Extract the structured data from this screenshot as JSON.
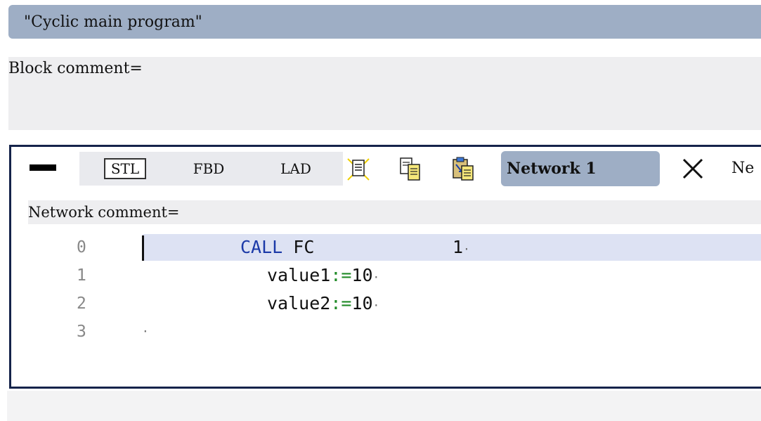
{
  "block": {
    "title": "\"Cyclic main program\"",
    "comment_label": "Block comment="
  },
  "network": {
    "tabs": [
      {
        "label": "STL",
        "selected": true
      },
      {
        "label": "FBD",
        "selected": false
      },
      {
        "label": "LAD",
        "selected": false
      }
    ],
    "toolbar_icons": [
      "new-page-icon",
      "copy-document-icon",
      "paste-document-icon"
    ],
    "title_button": "Network 1",
    "close_icon": "close-icon",
    "next_label_partial": "Ne",
    "comment_label": "Network comment=",
    "lines": [
      {
        "no": "0",
        "keyword": "CALL",
        "text": " FC",
        "arg": "1"
      },
      {
        "no": "1",
        "param": "value1",
        "op": ":=",
        "value": "10"
      },
      {
        "no": "2",
        "param": "value2",
        "op": ":=",
        "value": "10"
      },
      {
        "no": "3"
      }
    ]
  },
  "colors": {
    "title_bar": "#9eaec5",
    "keyword": "#1c3aa8",
    "operator": "#1f8a26",
    "active_line": "#dde2f3",
    "frame_border": "#15234a"
  }
}
